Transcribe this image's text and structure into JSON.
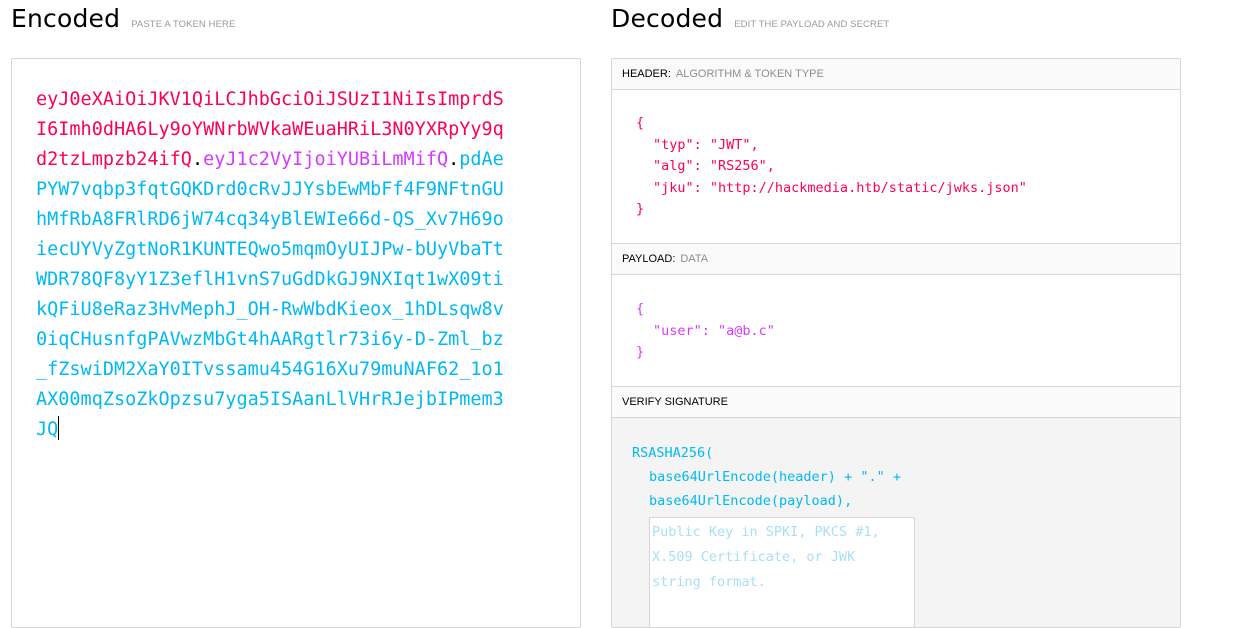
{
  "encoded": {
    "title": "Encoded",
    "subtitle": "PASTE A TOKEN HERE",
    "token_header": "eyJ0eXAiOiJKV1QiLCJhbGciOiJSUzI1NiIsImprdSI6Imh0dHA6Ly9oYWNrbWVkaWEuaHRiL3N0YXRpYy9qd2tzLmpzb24ifQ",
    "dot1": ".",
    "token_payload": "eyJ1c2VyIjoiYUBiLmMifQ",
    "dot2": ".",
    "token_signature": "pdAePYW7vqbp3fqtGQKDrd0cRvJJYsbEwMbFf4F9NFtnGUhMfRbA8FRlRD6jW74cq34yBlEWIe66d-QS_Xv7H69oiecUYVyZgtNoR1KUNTEQwo5mqmOyUIJPw-bUyVbaTtWDR78QF8yY1Z3eflH1vnS7uGdDkGJ9NXIqt1wX09tikQFiU8eRaz3HvMephJ_OH-RwWbdKieox_1hDLsqw8v0iqCHusnfgPAVwzMbGt4hAARgtlr73i6y-D-Zml_bz_fZswiDM2XaY0ITvssamu454G16Xu79muNAF62_1o1AX00mqZsoZkOpzsu7yga5ISAanLlVHrRJejbIPmem3JQ"
  },
  "decoded": {
    "title": "Decoded",
    "subtitle": "EDIT THE PAYLOAD AND SECRET",
    "header_section": {
      "label": "HEADER:",
      "hint": "ALGORITHM & TOKEN TYPE",
      "open": "{",
      "lines": [
        "\"typ\": \"JWT\",",
        "\"alg\": \"RS256\",",
        "\"jku\": \"http://hackmedia.htb/static/jwks.json\""
      ],
      "close": "}"
    },
    "payload_section": {
      "label": "PAYLOAD:",
      "hint": "DATA",
      "open": "{",
      "lines": [
        "\"user\": \"a@b.c\""
      ],
      "close": "}"
    },
    "verify_section": {
      "label": "VERIFY SIGNATURE",
      "fn_open": "RSASHA256(",
      "line1": "base64UrlEncode(header) + \".\" +",
      "line2": "base64UrlEncode(payload),",
      "public_key_placeholder": "Public Key in SPKI, PKCS #1, X.509 Certificate, or JWK string format.",
      "public_key_value": ""
    }
  },
  "colors": {
    "header": "#fb015b",
    "payload": "#d63aff",
    "signature": "#00b9f1"
  }
}
